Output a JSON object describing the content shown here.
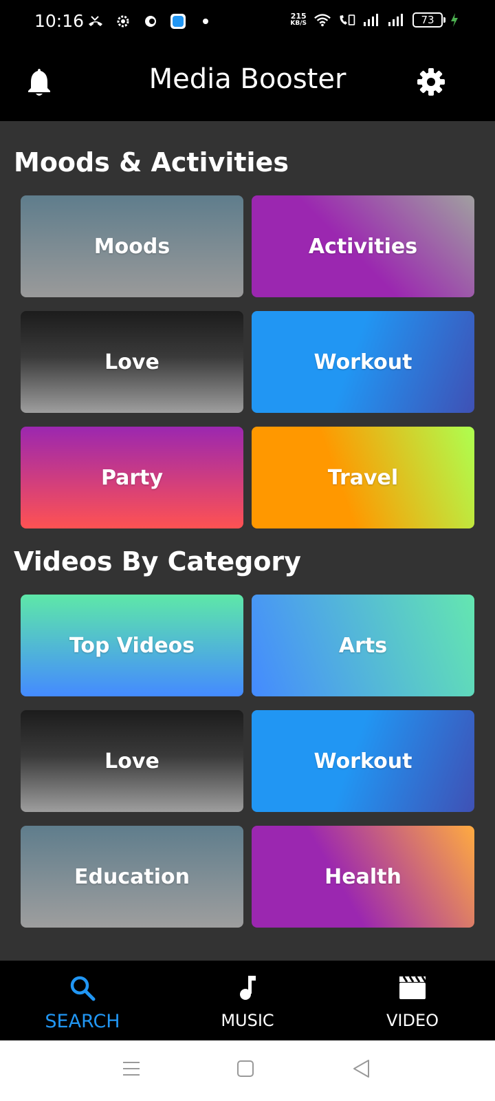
{
  "status_bar": {
    "time": "10:16",
    "net_speed_value": "215",
    "net_speed_unit": "KB/S",
    "battery": "73"
  },
  "app_bar": {
    "title": "Media Booster"
  },
  "sections": {
    "moods": {
      "title": "Moods & Activities",
      "tiles": [
        "Moods",
        "Activities",
        "Love",
        "Workout",
        "Party",
        "Travel"
      ]
    },
    "videos": {
      "title": "Videos By Category",
      "tiles": [
        "Top Videos",
        "Arts",
        "Love",
        "Workout",
        "Education",
        "Health"
      ]
    }
  },
  "bottom_nav": {
    "search": "SEARCH",
    "music": "MUSIC",
    "video": "VIDEO",
    "active_color": "#2196f3"
  },
  "icons": {
    "status_left": [
      "missed-call-icon",
      "settings-cog-icon",
      "app-notification-icon",
      "app-badge-icon",
      "dot-icon"
    ],
    "status_right": [
      "wifi-icon",
      "volte-icon",
      "signal-1-icon",
      "signal-2-icon",
      "battery-icon",
      "charging-icon"
    ],
    "app_bar": [
      "bell-icon",
      "gear-icon"
    ],
    "bottom_nav": [
      "search-icon",
      "music-note-icon",
      "clapperboard-icon"
    ],
    "system_nav": [
      "menu-icon",
      "home-icon",
      "back-icon"
    ]
  }
}
